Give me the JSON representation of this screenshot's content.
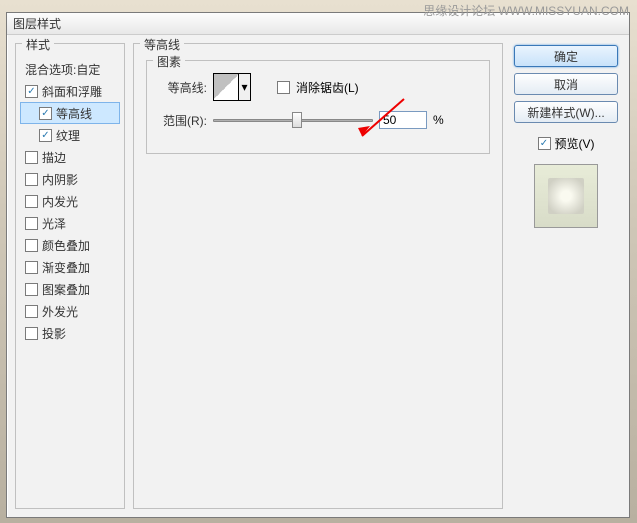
{
  "watermark": {
    "line1": "思缘设计论坛",
    "line2": "WWW.MISSYUAN.COM"
  },
  "dialog": {
    "title": "图层样式"
  },
  "left": {
    "heading": "样式",
    "blending": "混合选项:自定",
    "items": [
      {
        "label": "斜面和浮雕",
        "checked": true,
        "selected": false,
        "indent": false
      },
      {
        "label": "等高线",
        "checked": true,
        "selected": true,
        "indent": true
      },
      {
        "label": "纹理",
        "checked": true,
        "selected": false,
        "indent": true
      },
      {
        "label": "描边",
        "checked": false,
        "selected": false,
        "indent": false
      },
      {
        "label": "内阴影",
        "checked": false,
        "selected": false,
        "indent": false
      },
      {
        "label": "内发光",
        "checked": false,
        "selected": false,
        "indent": false
      },
      {
        "label": "光泽",
        "checked": false,
        "selected": false,
        "indent": false
      },
      {
        "label": "颜色叠加",
        "checked": false,
        "selected": false,
        "indent": false
      },
      {
        "label": "渐变叠加",
        "checked": false,
        "selected": false,
        "indent": false
      },
      {
        "label": "图案叠加",
        "checked": false,
        "selected": false,
        "indent": false
      },
      {
        "label": "外发光",
        "checked": false,
        "selected": false,
        "indent": false
      },
      {
        "label": "投影",
        "checked": false,
        "selected": false,
        "indent": false
      }
    ]
  },
  "mid": {
    "heading": "等高线",
    "inner_heading": "图素",
    "contour_label": "等高线:",
    "antialias_label": "消除锯齿(L)",
    "antialias_checked": false,
    "range_label": "范围(R):",
    "range_value": "50",
    "range_unit": "%"
  },
  "right": {
    "ok": "确定",
    "cancel": "取消",
    "newstyle": "新建样式(W)...",
    "preview_label": "预览(V)",
    "preview_checked": true
  }
}
